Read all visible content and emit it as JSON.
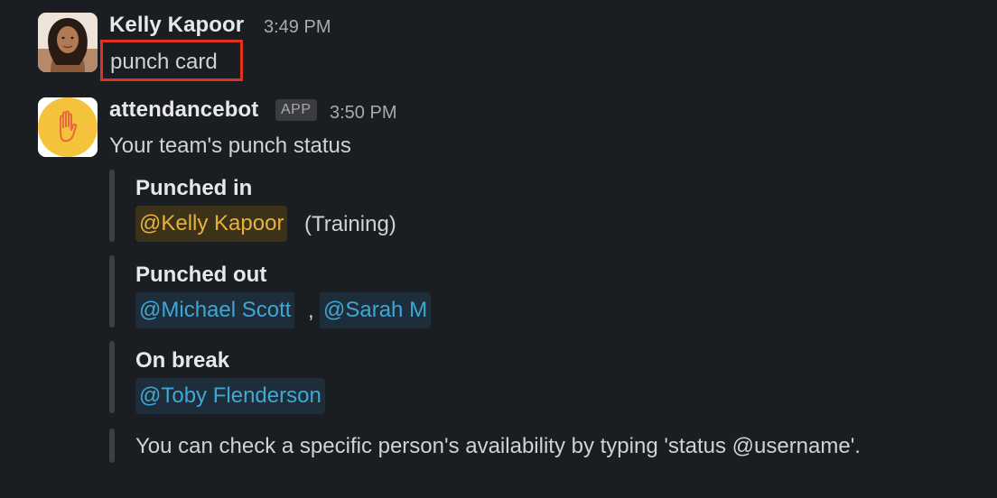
{
  "messages": [
    {
      "author": "Kelly Kapoor",
      "time": "3:49 PM",
      "text": "punch card"
    },
    {
      "author": "attendancebot",
      "badge": "APP",
      "time": "3:50 PM",
      "text": "Your team's punch status"
    }
  ],
  "sections": {
    "punched_in": {
      "title": "Punched in",
      "mention": "@Kelly Kapoor",
      "note": "(Training)"
    },
    "punched_out": {
      "title": "Punched out",
      "mention_1": "@Michael Scott",
      "separator": ",",
      "mention_2": "@Sarah M"
    },
    "on_break": {
      "title": "On break",
      "mention": "@Toby Flenderson"
    },
    "footer": "You can check a specific person's availability by typing 'status @username'."
  },
  "colors": {
    "background": "#1a1d21",
    "self_mention": "#e6b23c",
    "mention": "#3fa7d6",
    "highlight_box": "#e0321c",
    "bot_avatar": "#f5c33b"
  },
  "icons": {
    "bot_avatar": "raised-hand-icon",
    "user_avatar": "person-avatar"
  }
}
